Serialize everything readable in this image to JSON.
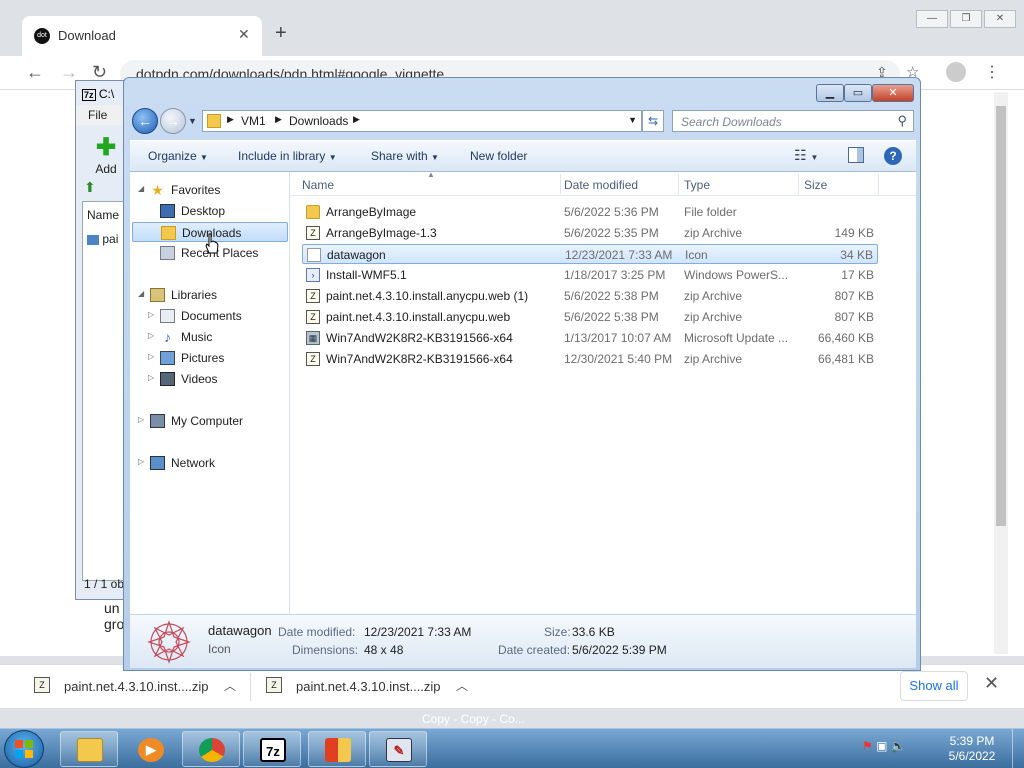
{
  "browser": {
    "tab_title": "Download",
    "favicon_text": "dot",
    "url": "dotpdn.com/downloads/pdn.html#google_vignette",
    "page_text_line1": "un",
    "page_text_line2": "gro",
    "downloads": [
      {
        "name": "paint.net.4.3.10.inst....zip"
      },
      {
        "name": "paint.net.4.3.10.inst....zip"
      }
    ],
    "show_all_label": "Show all"
  },
  "sevenzip": {
    "title": "C:\\",
    "menu_file": "File",
    "add_label": "Add",
    "col_name": "Name",
    "row_text": "pai",
    "status": "1 / 1 ob"
  },
  "explorer": {
    "breadcrumb": [
      "VM1",
      "Downloads"
    ],
    "search_placeholder": "Search Downloads",
    "commands": {
      "organize": "Organize",
      "include_in_library": "Include in library",
      "share_with": "Share with",
      "new_folder": "New folder"
    },
    "nav": {
      "favorites": "Favorites",
      "desktop": "Desktop",
      "downloads": "Downloads",
      "recent_places": "Recent Places",
      "libraries": "Libraries",
      "documents": "Documents",
      "music": "Music",
      "pictures": "Pictures",
      "videos": "Videos",
      "my_computer": "My Computer",
      "network": "Network"
    },
    "columns": {
      "name": "Name",
      "date_modified": "Date modified",
      "type": "Type",
      "size": "Size"
    },
    "files": [
      {
        "name": "ArrangeByImage",
        "date": "5/6/2022 5:36 PM",
        "type": "File folder",
        "size": "",
        "icon": "folder-icon"
      },
      {
        "name": "ArrangeByImage-1.3",
        "date": "5/6/2022 5:35 PM",
        "type": "zip Archive",
        "size": "149 KB",
        "icon": "zip-icon"
      },
      {
        "name": "datawagon",
        "date": "12/23/2021 7:33 AM",
        "type": "Icon",
        "size": "34 KB",
        "icon": "icon-file-icon"
      },
      {
        "name": "Install-WMF5.1",
        "date": "1/18/2017 3:25 PM",
        "type": "Windows PowerS...",
        "size": "17 KB",
        "icon": "powershell-icon"
      },
      {
        "name": "paint.net.4.3.10.install.anycpu.web (1)",
        "date": "5/6/2022 5:38 PM",
        "type": "zip Archive",
        "size": "807 KB",
        "icon": "zip-icon"
      },
      {
        "name": "paint.net.4.3.10.install.anycpu.web",
        "date": "5/6/2022 5:38 PM",
        "type": "zip Archive",
        "size": "807 KB",
        "icon": "zip-icon"
      },
      {
        "name": "Win7AndW2K8R2-KB3191566-x64",
        "date": "1/13/2017 10:07 AM",
        "type": "Microsoft Update ...",
        "size": "66,460 KB",
        "icon": "update-package-icon"
      },
      {
        "name": "Win7AndW2K8R2-KB3191566-x64",
        "date": "12/30/2021 5:40 PM",
        "type": "zip Archive",
        "size": "66,481 KB",
        "icon": "zip-icon"
      }
    ],
    "details": {
      "name": "datawagon",
      "type": "Icon",
      "date_modified_label": "Date modified:",
      "date_modified": "12/23/2021 7:33 AM",
      "dimensions_label": "Dimensions:",
      "dimensions": "48 x 48",
      "size_label": "Size:",
      "size": "33.6 KB",
      "date_created_label": "Date created:",
      "date_created": "5/6/2022 5:39 PM"
    }
  },
  "taskbar": {
    "peek_text": "Copy - Copy - Co...",
    "time": "5:39 PM",
    "date": "5/6/2022",
    "sevenzip_label": "7z"
  }
}
